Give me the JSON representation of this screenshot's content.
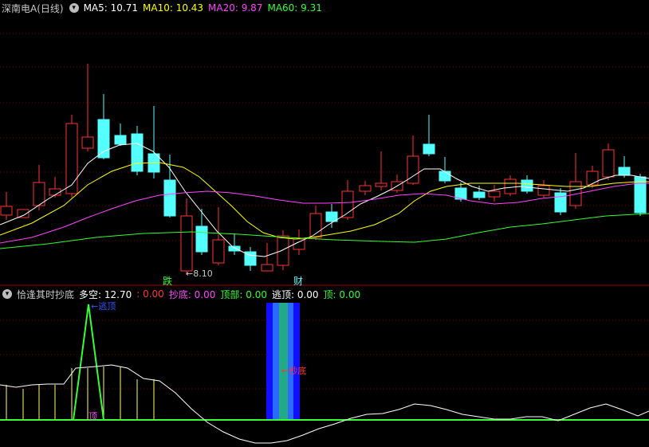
{
  "main_panel": {
    "title": "深南电A(日线)",
    "ma_items": [
      {
        "label": "MA5: 10.71",
        "color": "#ffffff"
      },
      {
        "label": "MA10: 10.43",
        "color": "#ffff00"
      },
      {
        "label": "MA20: 9.87",
        "color": "#ff44ff"
      },
      {
        "label": "MA60: 9.31",
        "color": "#33ff33"
      }
    ],
    "low_price_label": "←8.10",
    "marker_die": "跌",
    "marker_cai": "财"
  },
  "indicator_panel": {
    "title": "恰逢其时抄底",
    "items": [
      {
        "label": "多空: 12.70",
        "color": "#ffffff"
      },
      {
        "label": ": 0.00",
        "color": "#ff3333"
      },
      {
        "label": "抄底: 0.00",
        "color": "#ff44ff"
      },
      {
        "label": "顶部: 0.00",
        "color": "#33ff33"
      },
      {
        "label": "逃顶: 0.00",
        "color": "#ffffff"
      },
      {
        "label": "顶: 0.00",
        "color": "#33ff33"
      }
    ],
    "label_top": "顶",
    "label_escape_top": "←逃顶",
    "label_bottom": "←抄底"
  },
  "colors": {
    "up": "#ff3333",
    "down": "#54ffff",
    "grid": "#7a0000"
  }
}
